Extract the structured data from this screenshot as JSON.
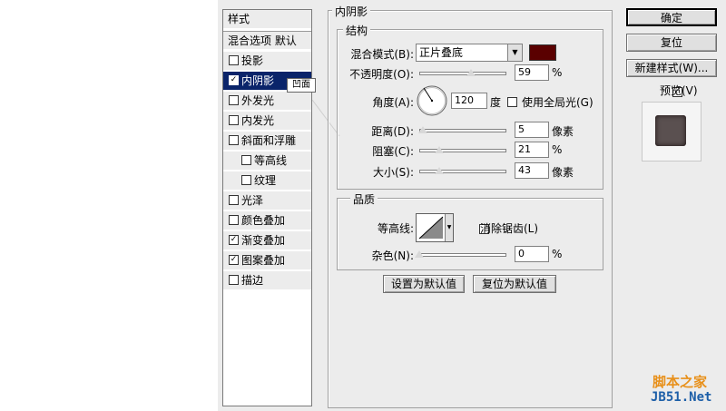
{
  "styles_panel": {
    "header": "样式",
    "blend_options": "混合选项 默认",
    "items": [
      {
        "label": "投影",
        "checked": false,
        "indented": false,
        "selected": false
      },
      {
        "label": "内阴影",
        "checked": true,
        "indented": false,
        "selected": true
      },
      {
        "label": "外发光",
        "checked": false,
        "indented": false,
        "selected": false
      },
      {
        "label": "内发光",
        "checked": false,
        "indented": false,
        "selected": false
      },
      {
        "label": "斜面和浮雕",
        "checked": false,
        "indented": false,
        "selected": false
      },
      {
        "label": "等高线",
        "checked": false,
        "indented": true,
        "selected": false
      },
      {
        "label": "纹理",
        "checked": false,
        "indented": true,
        "selected": false
      },
      {
        "label": "光泽",
        "checked": false,
        "indented": false,
        "selected": false
      },
      {
        "label": "颜色叠加",
        "checked": false,
        "indented": false,
        "selected": false
      },
      {
        "label": "渐变叠加",
        "checked": true,
        "indented": false,
        "selected": false
      },
      {
        "label": "图案叠加",
        "checked": true,
        "indented": false,
        "selected": false
      },
      {
        "label": "描边",
        "checked": false,
        "indented": false,
        "selected": false
      }
    ],
    "tooltip": "凹面"
  },
  "inner_shadow": {
    "title": "内阴影",
    "structure": {
      "title": "结构",
      "blend_mode_label": "混合模式(B):",
      "blend_mode_value": "正片叠底",
      "color": "#5a0000",
      "opacity_label": "不透明度(O):",
      "opacity_value": "59",
      "opacity_unit": "%",
      "angle_label": "角度(A):",
      "angle_value": "120",
      "angle_unit": "度",
      "global_light_label": "使用全局光(G)",
      "global_light_checked": false,
      "distance_label": "距离(D):",
      "distance_value": "5",
      "distance_unit": "像素",
      "choke_label": "阻塞(C):",
      "choke_value": "21",
      "choke_unit": "%",
      "size_label": "大小(S):",
      "size_value": "43",
      "size_unit": "像素"
    },
    "quality": {
      "title": "品质",
      "contour_label": "等高线:",
      "anti_alias_label": "消除锯齿(L)",
      "anti_alias_checked": false,
      "noise_label": "杂色(N):",
      "noise_value": "0",
      "noise_unit": "%"
    },
    "make_default": "设置为默认值",
    "reset_default": "复位为默认值"
  },
  "right": {
    "ok": "确定",
    "reset": "复位",
    "new_style": "新建样式(W)...",
    "preview_label": "预览(V)",
    "preview_checked": true
  },
  "watermark": {
    "line1": "脚本之家",
    "line2": "JB51.Net"
  },
  "colors": {
    "selection": "#0a246a",
    "panel_bg": "#ececec",
    "watermark_orange": "#e8901a",
    "watermark_blue": "#1d5fa8"
  }
}
